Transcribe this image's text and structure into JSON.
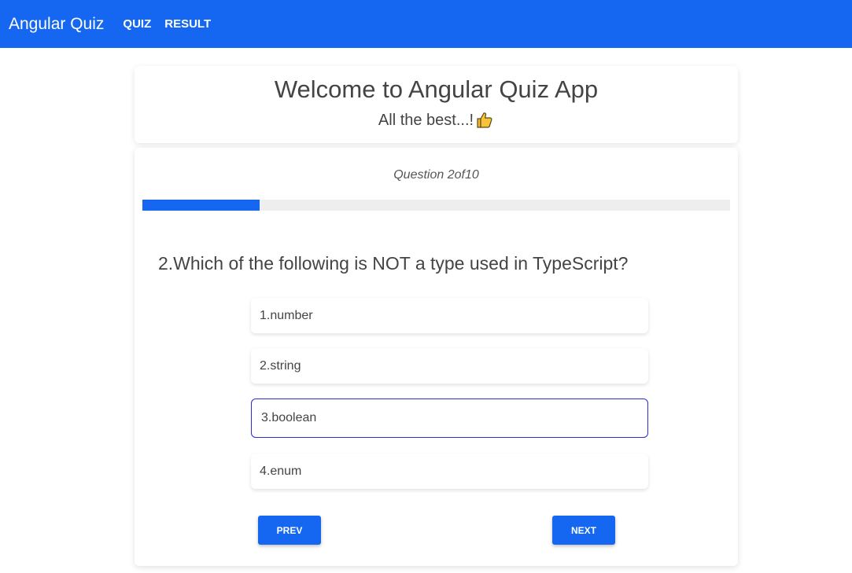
{
  "navbar": {
    "brand": "Angular Quiz",
    "links": [
      "QUIZ",
      "RESULT"
    ]
  },
  "welcome": {
    "title": "Welcome to Angular Quiz App",
    "subtitle": "All the best...!",
    "icon": "thumbs-up-icon"
  },
  "quiz": {
    "counter": "Question 2of10",
    "progress": 0.2,
    "question": "2.Which of the following is NOT a type used in TypeScript?",
    "options": [
      "1.number",
      "2.string",
      "3.boolean",
      "4.enum"
    ],
    "selected_index": 2,
    "prev_label": "PREV",
    "next_label": "NEXT"
  },
  "colors": {
    "primary": "#1567f2",
    "selected_border": "#2a2ad8",
    "progress_track": "#eeeeee"
  }
}
